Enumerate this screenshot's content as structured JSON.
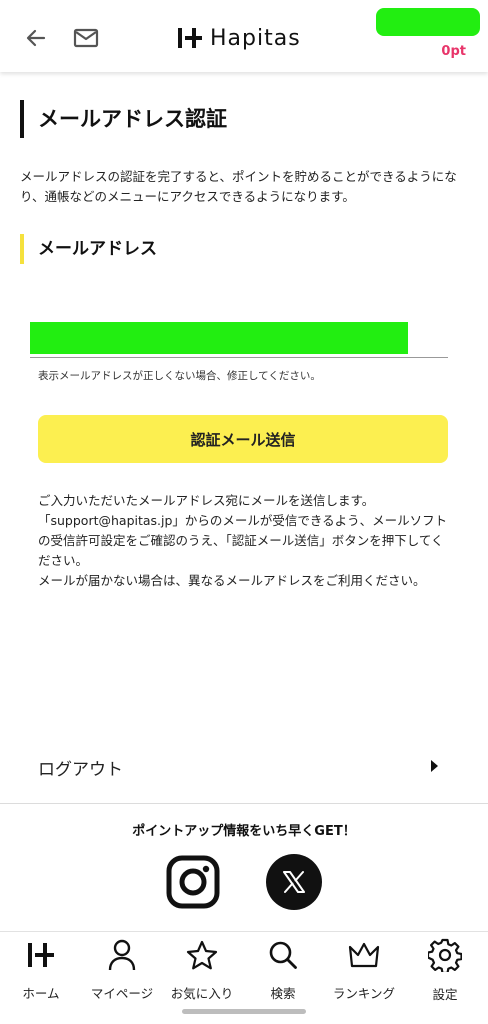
{
  "header": {
    "logo_text": "Hapitas",
    "points": "0pt"
  },
  "main": {
    "title": "メールアドレス認証",
    "intro": "メールアドレスの認証を完了すると、ポイントを貯めることができるようになり、通帳などのメニューにアクセスできるようになります。",
    "section_title": "メールアドレス",
    "email_note": "表示メールアドレスが正しくない場合、修正してください。",
    "send_button": "認証メール送信",
    "notice_lines": [
      "ご入力いただいたメールアドレス宛にメールを送信します。",
      "「support@hapitas.jp」からのメールが受信できるよう、メールソフトの受信許可設定をご確認のうえ、「認証メール送信」ボタンを押下してください。",
      "メールが届かない場合は、異なるメールアドレスをご利用ください。"
    ],
    "logout": "ログアウト"
  },
  "sns": {
    "title": "ポイントアップ情報をいち早くGET！"
  },
  "nav": {
    "items": [
      {
        "label": "ホーム",
        "icon": "home-logo-icon"
      },
      {
        "label": "マイページ",
        "icon": "person-icon"
      },
      {
        "label": "お気に入り",
        "icon": "star-icon"
      },
      {
        "label": "検索",
        "icon": "search-icon"
      },
      {
        "label": "ランキング",
        "icon": "crown-icon"
      },
      {
        "label": "設定",
        "icon": "gear-icon"
      }
    ]
  },
  "colors": {
    "accent_yellow": "#fcef50",
    "points_pink": "#e8356a",
    "redaction_green": "#22ee11"
  }
}
